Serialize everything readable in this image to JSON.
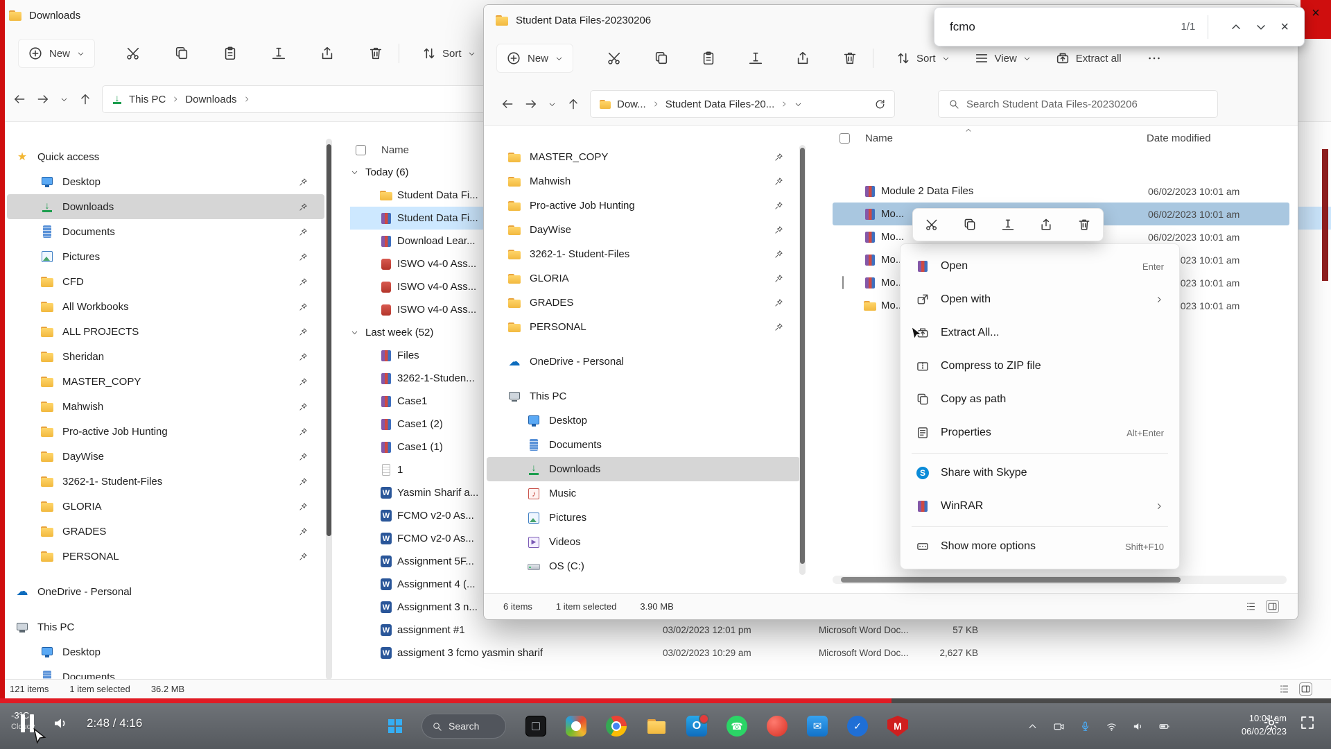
{
  "chrome": {
    "close_glyph": "×"
  },
  "find_bar": {
    "query": "fcmo",
    "matches": "1/1"
  },
  "player": {
    "time_display": "2:48 / 4:16",
    "progress_pct": 67
  },
  "bg_window": {
    "title": "Downloads",
    "toolbar": {
      "new_label": "New",
      "sort_label": "Sort",
      "icons": [
        "cut",
        "copy",
        "paste",
        "rename",
        "share",
        "delete"
      ]
    },
    "breadcrumbs": [
      "This PC",
      "Downloads"
    ],
    "sidebar": [
      {
        "label": "Quick access",
        "icon": "star",
        "header": true
      },
      {
        "label": "Desktop",
        "icon": "desktop",
        "pin": true
      },
      {
        "label": "Downloads",
        "icon": "download",
        "pin": true,
        "selected": true
      },
      {
        "label": "Documents",
        "icon": "documents",
        "pin": true
      },
      {
        "label": "Pictures",
        "icon": "pictures",
        "pin": true
      },
      {
        "label": "CFD",
        "icon": "folder",
        "pin": true
      },
      {
        "label": "All Workbooks",
        "icon": "folder",
        "pin": true
      },
      {
        "label": "ALL PROJECTS",
        "icon": "folder",
        "pin": true
      },
      {
        "label": "Sheridan",
        "icon": "folder",
        "pin": true
      },
      {
        "label": "MASTER_COPY",
        "icon": "folder",
        "pin": true
      },
      {
        "label": "Mahwish",
        "icon": "folder",
        "pin": true
      },
      {
        "label": "Pro-active Job Hunting",
        "icon": "folder",
        "pin": true
      },
      {
        "label": "DayWise",
        "icon": "folder",
        "pin": true
      },
      {
        "label": "3262-1- Student-Files",
        "icon": "folder",
        "pin": true
      },
      {
        "label": "GLORIA",
        "icon": "folder",
        "pin": true
      },
      {
        "label": "GRADES",
        "icon": "folder",
        "pin": true
      },
      {
        "label": "PERSONAL",
        "icon": "folder",
        "pin": true
      },
      {
        "label": "OneDrive - Personal",
        "icon": "cloud",
        "gap": true
      },
      {
        "label": "This PC",
        "icon": "pc",
        "gap": true
      },
      {
        "label": "Desktop",
        "icon": "desktop",
        "indent": true
      },
      {
        "label": "Documents",
        "icon": "documents",
        "indent": true
      }
    ],
    "list_header": "Name",
    "groups": [
      {
        "label": "Today (6)",
        "rows": [
          {
            "name": "Student Data Fi...",
            "icon": "folder"
          },
          {
            "name": "Student Data Fi...",
            "icon": "rar",
            "selected": true,
            "checked": true
          },
          {
            "name": "Download Lear...",
            "icon": "rar"
          },
          {
            "name": "ISWO v4-0 Ass...",
            "icon": "redfile"
          },
          {
            "name": "ISWO v4-0 Ass...",
            "icon": "redfile"
          },
          {
            "name": "ISWO v4-0 Ass...",
            "icon": "redfile"
          }
        ]
      },
      {
        "label": "Last week (52)",
        "rows": [
          {
            "name": "Files",
            "icon": "rar"
          },
          {
            "name": "3262-1-Studen...",
            "icon": "rar"
          },
          {
            "name": "Case1",
            "icon": "rar"
          },
          {
            "name": "Case1 (2)",
            "icon": "rar"
          },
          {
            "name": "Case1 (1)",
            "icon": "rar"
          },
          {
            "name": "1",
            "icon": "docfile"
          },
          {
            "name": "Yasmin Sharif a...",
            "icon": "word"
          },
          {
            "name": "FCMO v2-0 As...",
            "icon": "word"
          },
          {
            "name": "FCMO v2-0 As...",
            "icon": "word"
          },
          {
            "name": "Assignment 5F...",
            "icon": "word"
          },
          {
            "name": "Assignment 4 (...",
            "icon": "word"
          },
          {
            "name": "Assignment 3 n...",
            "icon": "word"
          },
          {
            "name": "assignment #1",
            "icon": "word",
            "date": "03/02/2023 12:01 pm",
            "type": "Microsoft Word Doc...",
            "size": "57 KB"
          },
          {
            "name": "assigment 3 fcmo yasmin sharif",
            "icon": "word",
            "date": "03/02/2023 10:29 am",
            "type": "Microsoft Word Doc...",
            "size": "2,627 KB"
          }
        ]
      }
    ],
    "status": {
      "items": "121 items",
      "selected": "1 item selected",
      "size": "36.2 MB"
    }
  },
  "fg_window": {
    "title": "Student Data Files-20230206",
    "toolbar": {
      "new_label": "New",
      "sort_label": "Sort",
      "view_label": "View",
      "extract_label": "Extract all",
      "icons": [
        "cut",
        "copy",
        "paste",
        "rename",
        "share",
        "delete"
      ]
    },
    "breadcrumbs": [
      "Dow...",
      "Student Data Files-20..."
    ],
    "search_placeholder": "Search Student Data Files-20230206",
    "sidebar": [
      {
        "label": "MASTER_COPY",
        "icon": "folder",
        "pin": true
      },
      {
        "label": "Mahwish",
        "icon": "folder",
        "pin": true
      },
      {
        "label": "Pro-active Job Hunting",
        "icon": "folder",
        "pin": true
      },
      {
        "label": "DayWise",
        "icon": "folder",
        "pin": true
      },
      {
        "label": "3262-1- Student-Files",
        "icon": "folder",
        "pin": true
      },
      {
        "label": "GLORIA",
        "icon": "folder",
        "pin": true
      },
      {
        "label": "GRADES",
        "icon": "folder",
        "pin": true
      },
      {
        "label": "PERSONAL",
        "icon": "folder",
        "pin": true
      },
      {
        "label": "OneDrive - Personal",
        "icon": "cloud",
        "gap": true
      },
      {
        "label": "This PC",
        "icon": "pc",
        "gap": true
      },
      {
        "label": "Desktop",
        "icon": "desktop",
        "indent": true
      },
      {
        "label": "Documents",
        "icon": "documents",
        "indent": true
      },
      {
        "label": "Downloads",
        "icon": "download",
        "indent": true,
        "selected": true
      },
      {
        "label": "Music",
        "icon": "music",
        "indent": true
      },
      {
        "label": "Pictures",
        "icon": "pictures",
        "indent": true
      },
      {
        "label": "Videos",
        "icon": "videos",
        "indent": true
      },
      {
        "label": "OS (C:)",
        "icon": "drive",
        "indent": true
      }
    ],
    "columns": {
      "name": "Name",
      "date": "Date modified"
    },
    "rows": [
      {
        "name": "Module 2 Data Files",
        "icon": "rar",
        "date": "06/02/2023 10:01 am"
      },
      {
        "name": "Mo...",
        "icon": "rar",
        "date": "06/02/2023 10:01 am",
        "selected": true,
        "checked": true
      },
      {
        "name": "Mo...",
        "icon": "rar",
        "date": "06/02/2023 10:01 am"
      },
      {
        "name": "Mo...",
        "icon": "rar",
        "date": "06/02/2023 10:01 am"
      },
      {
        "name": "Mo...",
        "icon": "rar",
        "date": "06/02/2023 10:01 am",
        "checkbox": true
      },
      {
        "name": "Mo...",
        "icon": "folder",
        "date": "06/02/2023 10:01 am"
      }
    ],
    "status": {
      "items": "6 items",
      "selected": "1 item selected",
      "size": "3.90 MB"
    }
  },
  "context_menu": {
    "quick_icons": [
      "cut",
      "copy",
      "rename",
      "share",
      "delete"
    ],
    "items": [
      {
        "label": "Open",
        "icon": "rar",
        "shortcut": "Enter"
      },
      {
        "label": "Open with",
        "icon": "openwith",
        "submenu": true
      },
      {
        "label": "Extract All...",
        "icon": "extract"
      },
      {
        "label": "Compress to ZIP file",
        "icon": "zip"
      },
      {
        "label": "Copy as path",
        "icon": "copypath"
      },
      {
        "label": "Properties",
        "icon": "properties",
        "shortcut": "Alt+Enter"
      },
      {
        "divider": true
      },
      {
        "label": "Share with Skype",
        "icon": "skype"
      },
      {
        "label": "WinRAR",
        "icon": "rar",
        "submenu": true
      },
      {
        "divider": true
      },
      {
        "label": "Show more options",
        "icon": "more_options",
        "shortcut": "Shift+F10"
      }
    ]
  },
  "taskbar": {
    "weather_temp": "-3°C",
    "weather_cond": "Cloudy",
    "search_label": "Search",
    "apps": [
      "app-dark",
      "snipping",
      "chrome",
      "file-explorer",
      "outlook",
      "whatsapp",
      "app-red",
      "mail",
      "todo",
      "mcafee"
    ],
    "tray": [
      "chevron-up",
      "camera",
      "mic",
      "wifi",
      "speaker",
      "battery"
    ],
    "clock_time": "10:01 am",
    "clock_date": "06/02/2023"
  }
}
